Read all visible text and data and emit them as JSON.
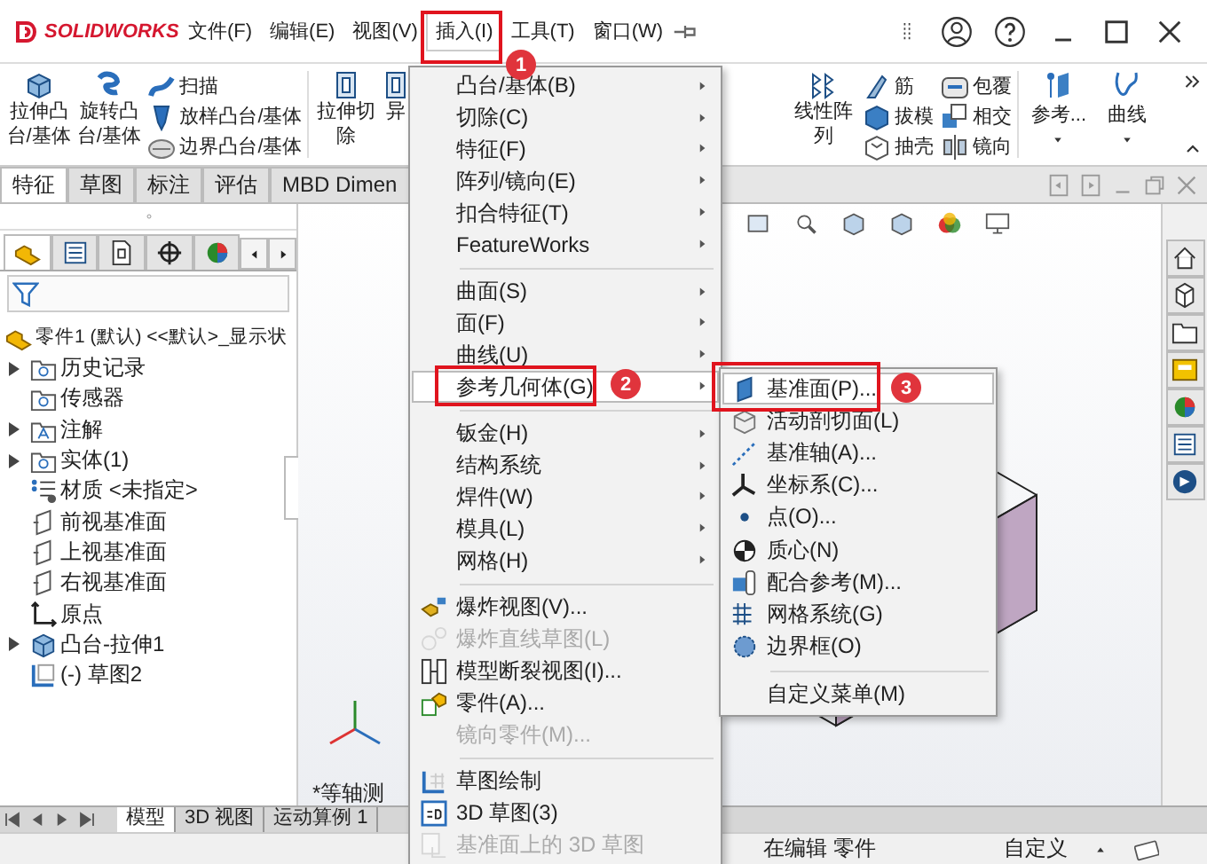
{
  "title_bar": {
    "logo": "SOLIDWORKS",
    "menus": [
      {
        "label": "文件(F)",
        "selected": false
      },
      {
        "label": "编辑(E)",
        "selected": false
      },
      {
        "label": "视图(V)",
        "selected": false
      },
      {
        "label": "插入(I)",
        "selected": true
      },
      {
        "label": "工具(T)",
        "selected": false
      },
      {
        "label": "窗口(W)",
        "selected": false
      }
    ]
  },
  "ribbon": {
    "left": [
      {
        "kind": "large",
        "label": "拉伸凸台/基体"
      },
      {
        "kind": "large",
        "label": "旋转凸台/基体"
      },
      {
        "kind": "stack",
        "items": [
          "扫描",
          "放样凸台/基体",
          "边界凸台/基体"
        ]
      },
      {
        "kind": "large",
        "label": "拉伸切除"
      },
      {
        "kind": "large",
        "label": "异"
      }
    ],
    "right": [
      {
        "kind": "large",
        "label": "线性阵列"
      },
      {
        "kind": "stack",
        "items": [
          "筋",
          "拔模",
          "抽壳"
        ]
      },
      {
        "kind": "stack",
        "items": [
          "包覆",
          "相交",
          "镜向"
        ]
      },
      {
        "kind": "dropdown",
        "label": "参考..."
      },
      {
        "kind": "dropdown",
        "label": "曲线"
      }
    ]
  },
  "command_tabs": [
    {
      "label": "特征",
      "selected": true
    },
    {
      "label": "草图",
      "selected": false
    },
    {
      "label": "标注",
      "selected": false
    },
    {
      "label": "评估",
      "selected": false
    },
    {
      "label": "MBD Dimen",
      "selected": false
    }
  ],
  "feature_manager": {
    "tabs": [
      {
        "selected": true
      },
      {
        "selected": false
      },
      {
        "selected": false
      },
      {
        "selected": false
      },
      {
        "selected": false
      }
    ],
    "tree": {
      "label": "零件1 (默认) <<默认>_显示状",
      "children": [
        {
          "label": "历史记录",
          "expandable": true
        },
        {
          "label": "传感器",
          "expandable": false
        },
        {
          "label": "注解",
          "expandable": true
        },
        {
          "label": "实体(1)",
          "expandable": true
        },
        {
          "label": "材质 <未指定>",
          "expandable": false
        },
        {
          "label": "前视基准面",
          "expandable": false
        },
        {
          "label": "上视基准面",
          "expandable": false
        },
        {
          "label": "右视基准面",
          "expandable": false
        },
        {
          "label": "原点",
          "expandable": false
        },
        {
          "label": "凸台-拉伸1",
          "expandable": true
        },
        {
          "label": "(-) 草图2",
          "expandable": false
        }
      ]
    }
  },
  "graphics": {
    "view_label": "*等轴测"
  },
  "bottom_tabs": [
    {
      "label": "模型",
      "selected": true
    },
    {
      "label": "3D 视图",
      "selected": false
    },
    {
      "label": "运动算例 1",
      "selected": false
    }
  ],
  "status_bar": {
    "left": "在编辑 零件",
    "right": "自定义"
  },
  "insert_menu": {
    "groups": [
      [
        {
          "label": "凸台/基体(B)",
          "submenu": true,
          "disabled": false,
          "selected": false
        },
        {
          "label": "切除(C)",
          "submenu": true,
          "disabled": false,
          "selected": false
        },
        {
          "label": "特征(F)",
          "submenu": true,
          "disabled": false,
          "selected": false
        },
        {
          "label": "阵列/镜向(E)",
          "submenu": true,
          "disabled": false,
          "selected": false
        },
        {
          "label": "扣合特征(T)",
          "submenu": true,
          "disabled": false,
          "selected": false
        },
        {
          "label": "FeatureWorks",
          "submenu": true,
          "disabled": false,
          "selected": false
        }
      ],
      [
        {
          "label": "曲面(S)",
          "submenu": true,
          "disabled": false,
          "selected": false
        },
        {
          "label": "面(F)",
          "submenu": true,
          "disabled": false,
          "selected": false
        },
        {
          "label": "曲线(U)",
          "submenu": true,
          "disabled": false,
          "selected": false
        },
        {
          "label": "参考几何体(G)",
          "submenu": true,
          "disabled": false,
          "selected": true
        }
      ],
      [
        {
          "label": "钣金(H)",
          "submenu": true,
          "disabled": false,
          "selected": false
        },
        {
          "label": "结构系统",
          "submenu": true,
          "disabled": false,
          "selected": false
        },
        {
          "label": "焊件(W)",
          "submenu": true,
          "disabled": false,
          "selected": false
        },
        {
          "label": "模具(L)",
          "submenu": true,
          "disabled": false,
          "selected": false
        },
        {
          "label": "网格(H)",
          "submenu": true,
          "disabled": false,
          "selected": false
        }
      ],
      [
        {
          "label": "爆炸视图(V)...",
          "submenu": false,
          "disabled": false,
          "selected": false
        },
        {
          "label": "爆炸直线草图(L)",
          "submenu": false,
          "disabled": true,
          "selected": false
        },
        {
          "label": "模型断裂视图(I)...",
          "submenu": false,
          "disabled": false,
          "selected": false
        },
        {
          "label": "零件(A)...",
          "submenu": false,
          "disabled": false,
          "selected": false
        },
        {
          "label": "镜向零件(M)...",
          "submenu": false,
          "disabled": true,
          "selected": false
        }
      ],
      [
        {
          "label": "草图绘制",
          "submenu": false,
          "disabled": false,
          "selected": false
        },
        {
          "label": "3D 草图(3)",
          "submenu": false,
          "disabled": false,
          "selected": false
        },
        {
          "label": "基准面上的 3D 草图",
          "submenu": false,
          "disabled": true,
          "selected": false
        }
      ]
    ]
  },
  "reference_geometry_menu": {
    "groups": [
      [
        {
          "label": "基准面(P)...",
          "submenu": false,
          "disabled": false,
          "selected": true
        },
        {
          "label": "活动剖切面(L)",
          "submenu": false,
          "disabled": false,
          "selected": false
        },
        {
          "label": "基准轴(A)...",
          "submenu": false,
          "disabled": false,
          "selected": false
        },
        {
          "label": "坐标系(C)...",
          "submenu": false,
          "disabled": false,
          "selected": false
        },
        {
          "label": "点(O)...",
          "submenu": false,
          "disabled": false,
          "selected": false
        },
        {
          "label": "质心(N)",
          "submenu": false,
          "disabled": false,
          "selected": false
        },
        {
          "label": "配合参考(M)...",
          "submenu": false,
          "disabled": false,
          "selected": false
        },
        {
          "label": "网格系统(G)",
          "submenu": false,
          "disabled": false,
          "selected": false
        },
        {
          "label": "边界框(O)",
          "submenu": false,
          "disabled": false,
          "selected": false
        }
      ],
      [
        {
          "label": "自定义菜单(M)",
          "submenu": false,
          "disabled": false,
          "selected": false
        }
      ]
    ]
  },
  "callouts": [
    {
      "number": "1"
    },
    {
      "number": "2"
    },
    {
      "number": "3"
    }
  ]
}
